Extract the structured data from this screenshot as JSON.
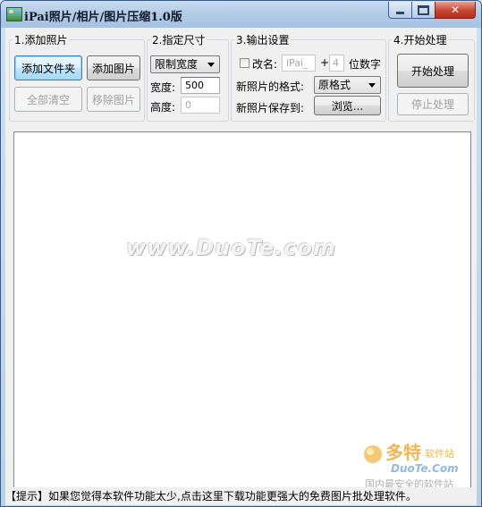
{
  "window": {
    "title": "iPai照片/相片/图片压缩1.0版",
    "min_glyph": "",
    "max_glyph": "",
    "close_glyph": "✕"
  },
  "group_add": {
    "legend": "1.添加照片",
    "add_folder": "添加文件夹",
    "add_image": "添加图片",
    "clear_all": "全部清空",
    "remove_image": "移除图片"
  },
  "group_size": {
    "legend": "2.指定尺寸",
    "mode_selected": "限制宽度",
    "width_label": "宽度:",
    "width_value": "500",
    "height_label": "高度:",
    "height_value": "0"
  },
  "group_output": {
    "legend": "3.输出设置",
    "rename_label": "改名:",
    "rename_prefix": "iPai_",
    "plus": "+",
    "digits_value": "4",
    "digits_label": "位数字",
    "format_label": "新照片的格式:",
    "format_selected": "原格式",
    "save_label": "新照片保存到:",
    "browse": "浏览..."
  },
  "group_process": {
    "legend": "4.开始处理",
    "start": "开始处理",
    "stop": "停止处理"
  },
  "watermark": {
    "text": "www.DuoTe.com",
    "logo_cn": "多特",
    "logo_cn_small": "软件站",
    "logo_en": "DuoTe.Com",
    "logo_tagline": "国内最安全的软件站"
  },
  "status": {
    "text": "【提示】如果您觉得本软件功能太少,点击这里下载功能更强大的免费图片批处理软件。"
  },
  "colors": {
    "title_bar": "#b1cae6",
    "close_button": "#c74532",
    "logo_orange": "#f0a020",
    "logo_blue": "#2f7fd0"
  }
}
